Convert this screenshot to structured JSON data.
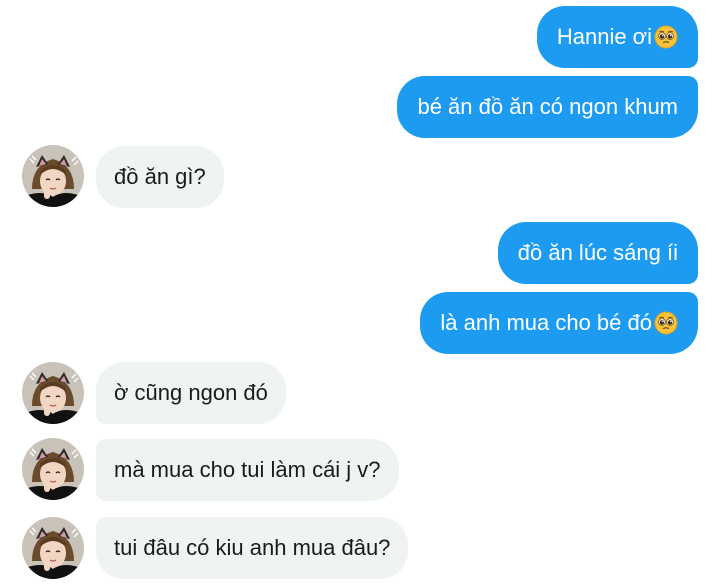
{
  "messages": [
    {
      "from": "me",
      "text": "Hannie ơi",
      "emoji": "pleading-face"
    },
    {
      "from": "me",
      "text": "bé ăn đồ ăn có ngon khum"
    },
    {
      "from": "them",
      "text": "đồ ăn gì?"
    },
    {
      "from": "me",
      "text": "đồ ăn lúc sáng íi"
    },
    {
      "from": "me",
      "text": "là anh mua cho bé đó",
      "emoji": "pleading-face"
    },
    {
      "from": "them",
      "text": "ờ cũng ngon đó"
    },
    {
      "from": "them",
      "text": "mà mua cho tui làm cái j v?"
    },
    {
      "from": "them",
      "text": "tui đâu có kiu anh mua đâu?"
    }
  ],
  "colors": {
    "outgoing_bubble": "#1d9bf0",
    "incoming_bubble": "#eff3f4",
    "outgoing_text": "#ffffff",
    "incoming_text": "#1b1b1b"
  },
  "avatar": {
    "icon": "contact-avatar-cat-ear-icon"
  }
}
